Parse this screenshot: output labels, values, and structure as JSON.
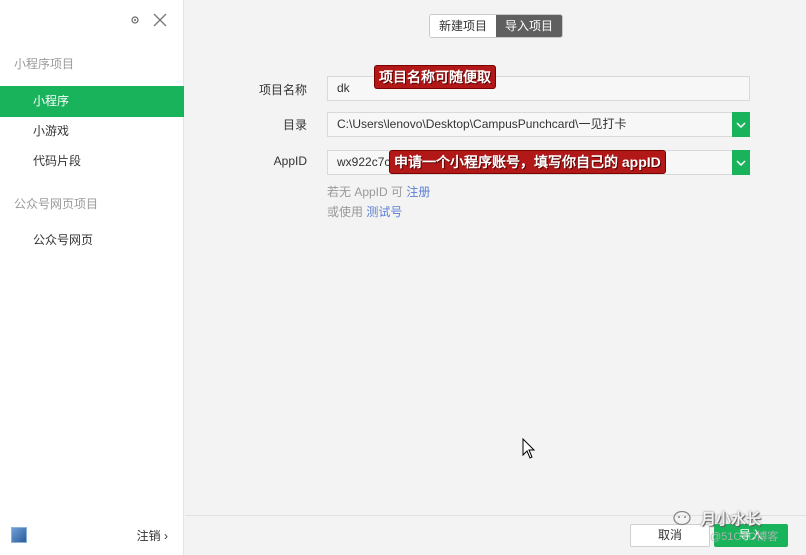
{
  "sidebar": {
    "section_mini": "小程序项目",
    "items_mini": [
      {
        "label": "小程序"
      },
      {
        "label": "小游戏"
      },
      {
        "label": "代码片段"
      }
    ],
    "section_oa": "公众号网页项目",
    "items_oa": [
      {
        "label": "公众号网页"
      }
    ],
    "logout_label": "注销 ›"
  },
  "tabs": [
    {
      "label": "新建项目"
    },
    {
      "label": "导入项目"
    }
  ],
  "form": {
    "name_label": "项目名称",
    "name_value": "dk",
    "dir_label": "目录",
    "dir_value": "C:\\Users\\lenovo\\Desktop\\CampusPunchcard\\一见打卡",
    "appid_label": "AppID",
    "appid_value": "wx922c7c",
    "hint1_prefix": "若无 AppID 可",
    "hint1_link": "注册",
    "hint2_prefix": "或使用",
    "hint2_link": "测试号"
  },
  "annotations": {
    "note1": "项目名称可随便取",
    "note2": "申请一个小程序账号，填写你自己的 appID"
  },
  "buttons": {
    "cancel": "取消",
    "import": "导入"
  },
  "watermark": {
    "text": "月小水长",
    "sub": "@51CTO博客"
  },
  "colors": {
    "accent": "#19b35b",
    "note_bg": "#b21818",
    "link": "#5b7fd6"
  }
}
